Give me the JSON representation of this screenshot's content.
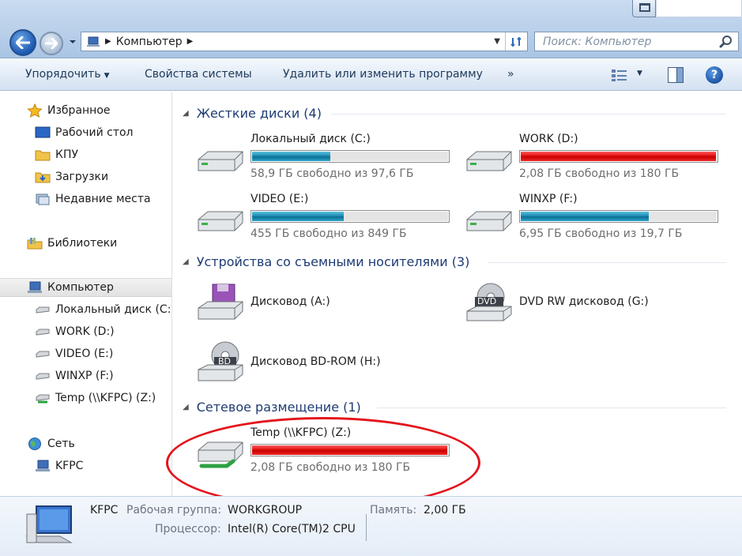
{
  "address": {
    "crumbs": [
      "Компьютер"
    ],
    "search_placeholder": "Поиск: Компьютер"
  },
  "toolbar": {
    "organize": "Упорядочить",
    "system_properties": "Свойства системы",
    "uninstall": "Удалить или изменить программу",
    "more": "»"
  },
  "nav": {
    "favorites": "Избранное",
    "desktop": "Рабочий стол",
    "kpu": "КПУ",
    "downloads": "Загрузки",
    "recent": "Недавние места",
    "libraries": "Библиотеки",
    "computer": "Компьютер",
    "drive_c": "Локальный диск (C:",
    "drive_d": "WORK (D:)",
    "drive_e": "VIDEO (E:)",
    "drive_f": "WINXP (F:)",
    "drive_z": "Temp (\\\\KFPC) (Z:)",
    "network": "Сеть",
    "kfpc": "KFPC"
  },
  "groups": {
    "hdd": "Жесткие диски (4)",
    "removable": "Устройства со съемными носителями (3)",
    "network": "Сетевое размещение (1)"
  },
  "drives": {
    "c": {
      "name": "Локальный диск (C:)",
      "free": "58,9 ГБ свободно из 97,6 ГБ",
      "used_fraction": 0.397,
      "bar_color": "blue"
    },
    "d": {
      "name": "WORK (D:)",
      "free": "2,08 ГБ свободно из 180 ГБ",
      "used_fraction": 0.988,
      "bar_color": "red"
    },
    "e": {
      "name": "VIDEO (E:)",
      "free": "455 ГБ свободно из 849 ГБ",
      "used_fraction": 0.464,
      "bar_color": "blue"
    },
    "f": {
      "name": "WINXP (F:)",
      "free": "6,95 ГБ свободно из 19,7 ГБ",
      "used_fraction": 0.647,
      "bar_color": "blue"
    },
    "z": {
      "name": "Temp (\\\\KFPC) (Z:)",
      "free": "2,08 ГБ свободно из 180 ГБ",
      "used_fraction": 0.988,
      "bar_color": "red"
    }
  },
  "removable": {
    "a": "Дисковод (A:)",
    "g": "DVD RW дисковод (G:)",
    "h": "Дисковод BD-ROM (H:)",
    "dvd_badge": "DVD",
    "bd_badge": "BD"
  },
  "details": {
    "name": "KFPC",
    "workgroup_label": "Рабочая группа:",
    "workgroup_value": "WORKGROUP",
    "memory_label": "Память:",
    "memory_value": "2,00 ГБ",
    "cpu_label": "Процессор:",
    "cpu_value": "Intel(R) Core(TM)2 CPU"
  },
  "colors": {
    "group_heading": "#1e3b73",
    "bar_blue": "#1d8bb3",
    "bar_red": "#e01010",
    "annotation": "#e4141c"
  }
}
